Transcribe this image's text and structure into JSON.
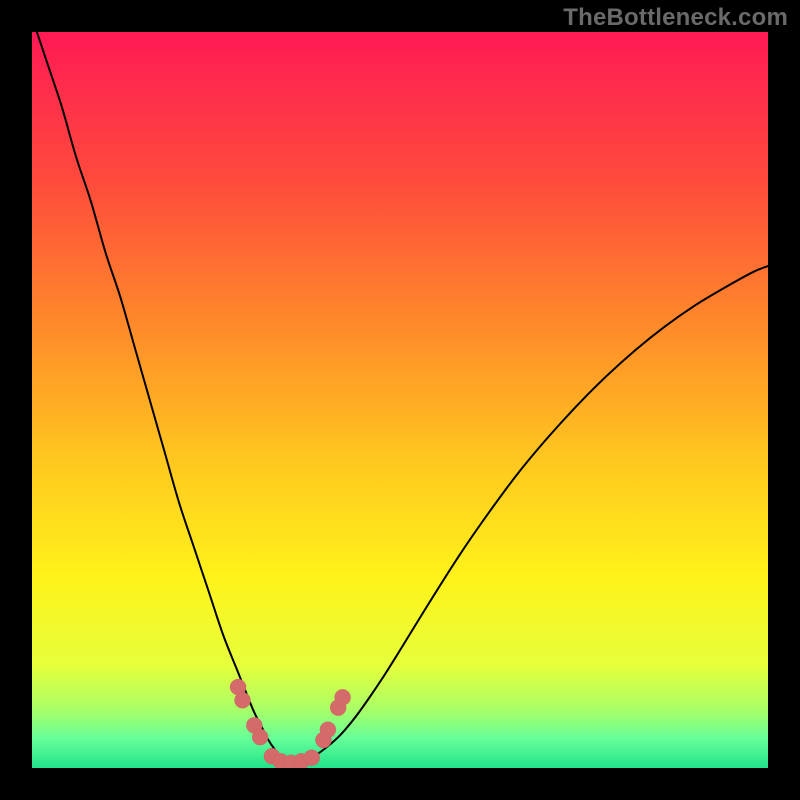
{
  "watermark": {
    "text": "TheBottleneck.com"
  },
  "colors": {
    "bg": "#000000",
    "watermark": "#6a6a6a",
    "gradient_stops": [
      {
        "offset": 0.0,
        "color": "#ff1a55"
      },
      {
        "offset": 0.2,
        "color": "#ff4a3c"
      },
      {
        "offset": 0.4,
        "color": "#ff8a2a"
      },
      {
        "offset": 0.58,
        "color": "#ffc71f"
      },
      {
        "offset": 0.74,
        "color": "#fff21a"
      },
      {
        "offset": 0.86,
        "color": "#e6ff3a"
      },
      {
        "offset": 0.92,
        "color": "#aaff66"
      },
      {
        "offset": 0.96,
        "color": "#66ff99"
      },
      {
        "offset": 1.0,
        "color": "#22e38a"
      }
    ],
    "curve": "#000000",
    "marker_fill": "#d46a6a",
    "marker_stroke": "#c05a5a"
  },
  "chart_data": {
    "type": "line",
    "title": "",
    "xlabel": "",
    "ylabel": "",
    "xlim": [
      0,
      100
    ],
    "ylim": [
      0,
      100
    ],
    "grid": false,
    "legend": false,
    "series": [
      {
        "name": "curve",
        "x": [
          0,
          2,
          4,
          6,
          8,
          10,
          12,
          14,
          16,
          18,
          20,
          22,
          24,
          26,
          28,
          30,
          31,
          32,
          33,
          34,
          35,
          36,
          38,
          40,
          42,
          44,
          46,
          48,
          50,
          54,
          58,
          62,
          66,
          70,
          74,
          78,
          82,
          86,
          90,
          94,
          98,
          100
        ],
        "y": [
          102,
          96,
          90,
          83,
          77,
          70,
          64,
          57,
          50,
          43,
          36,
          30,
          24,
          18,
          13,
          8,
          6,
          4,
          2.5,
          1.4,
          0.7,
          0.7,
          1.4,
          2.8,
          4.6,
          7.0,
          9.8,
          12.8,
          16.0,
          22.5,
          28.8,
          34.6,
          40.0,
          44.8,
          49.2,
          53.2,
          56.8,
          60.0,
          62.8,
          65.2,
          67.4,
          68.2
        ]
      }
    ],
    "markers": {
      "name": "bottom-dots",
      "points": [
        {
          "x": 28.0,
          "y": 11.0
        },
        {
          "x": 28.6,
          "y": 9.2
        },
        {
          "x": 30.2,
          "y": 5.8
        },
        {
          "x": 31.0,
          "y": 4.2
        },
        {
          "x": 32.6,
          "y": 1.6
        },
        {
          "x": 33.8,
          "y": 0.9
        },
        {
          "x": 35.2,
          "y": 0.7
        },
        {
          "x": 36.6,
          "y": 0.9
        },
        {
          "x": 38.0,
          "y": 1.4
        },
        {
          "x": 39.6,
          "y": 3.8
        },
        {
          "x": 40.2,
          "y": 5.2
        },
        {
          "x": 41.6,
          "y": 8.2
        },
        {
          "x": 42.2,
          "y": 9.6
        }
      ]
    }
  }
}
